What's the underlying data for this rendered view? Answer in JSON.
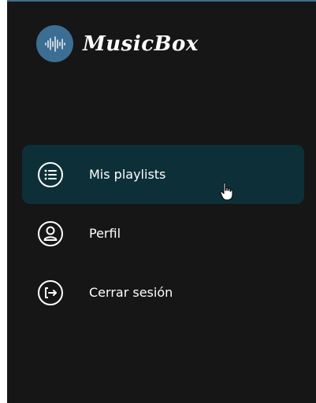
{
  "brand": {
    "name": "MusicBox",
    "logo_icon": "soundwave-icon",
    "badge_color": "#3c6e94"
  },
  "nav": {
    "items": [
      {
        "label": "Mis playlists",
        "icon": "list-icon",
        "active": true
      },
      {
        "label": "Perfil",
        "icon": "user-icon",
        "active": false
      },
      {
        "label": "Cerrar sesión",
        "icon": "logout-icon",
        "active": false
      }
    ]
  },
  "colors": {
    "background": "#161616",
    "active_item": "#0d3038",
    "top_border": "#3d6f8e"
  }
}
